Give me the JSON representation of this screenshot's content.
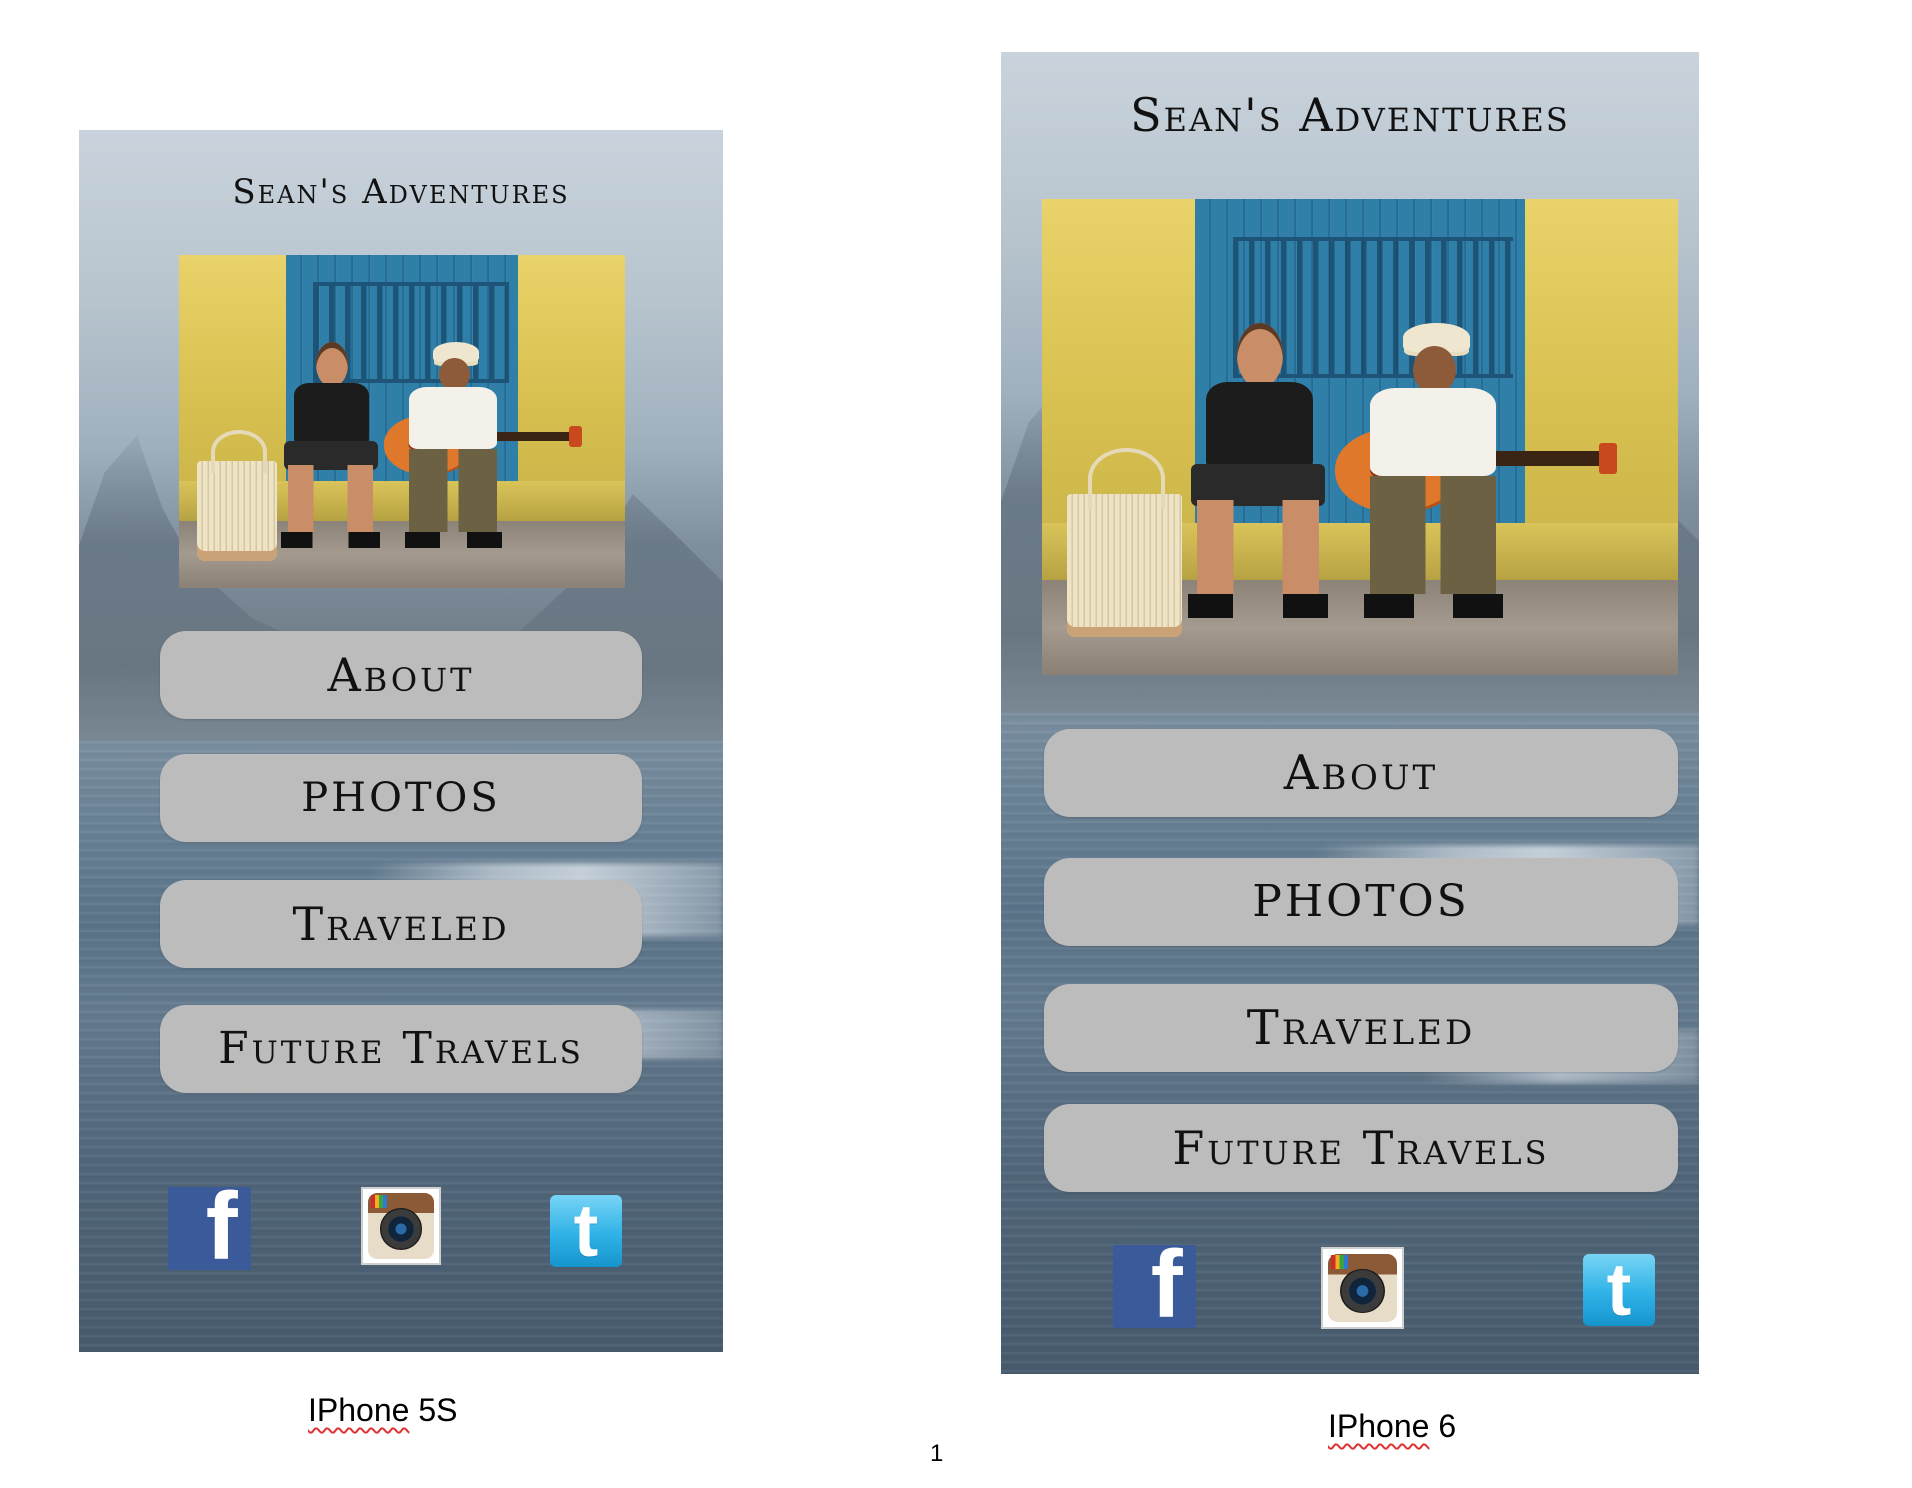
{
  "mockups": [
    {
      "title": "Sean's Adventures",
      "buttons": [
        "About",
        "PHOTOS",
        "Traveled",
        "Future Travels"
      ],
      "social": [
        "facebook-icon",
        "instagram-icon",
        "twitter-icon"
      ],
      "caption_device": "IPhone",
      "caption_model": " 5S"
    },
    {
      "title": "Sean's Adventures",
      "buttons": [
        "About",
        "PHOTOS",
        "Traveled",
        "Future Travels"
      ],
      "social": [
        "facebook-icon",
        "instagram-icon",
        "twitter-icon"
      ],
      "caption_device": "IPhone",
      "caption_model": " 6"
    }
  ],
  "page_number": "1",
  "colors": {
    "button_bg": "#bcbcbc",
    "facebook": "#3b5a9a",
    "twitter": "#2fb2e7",
    "spellcheck_underline": "#d33"
  }
}
